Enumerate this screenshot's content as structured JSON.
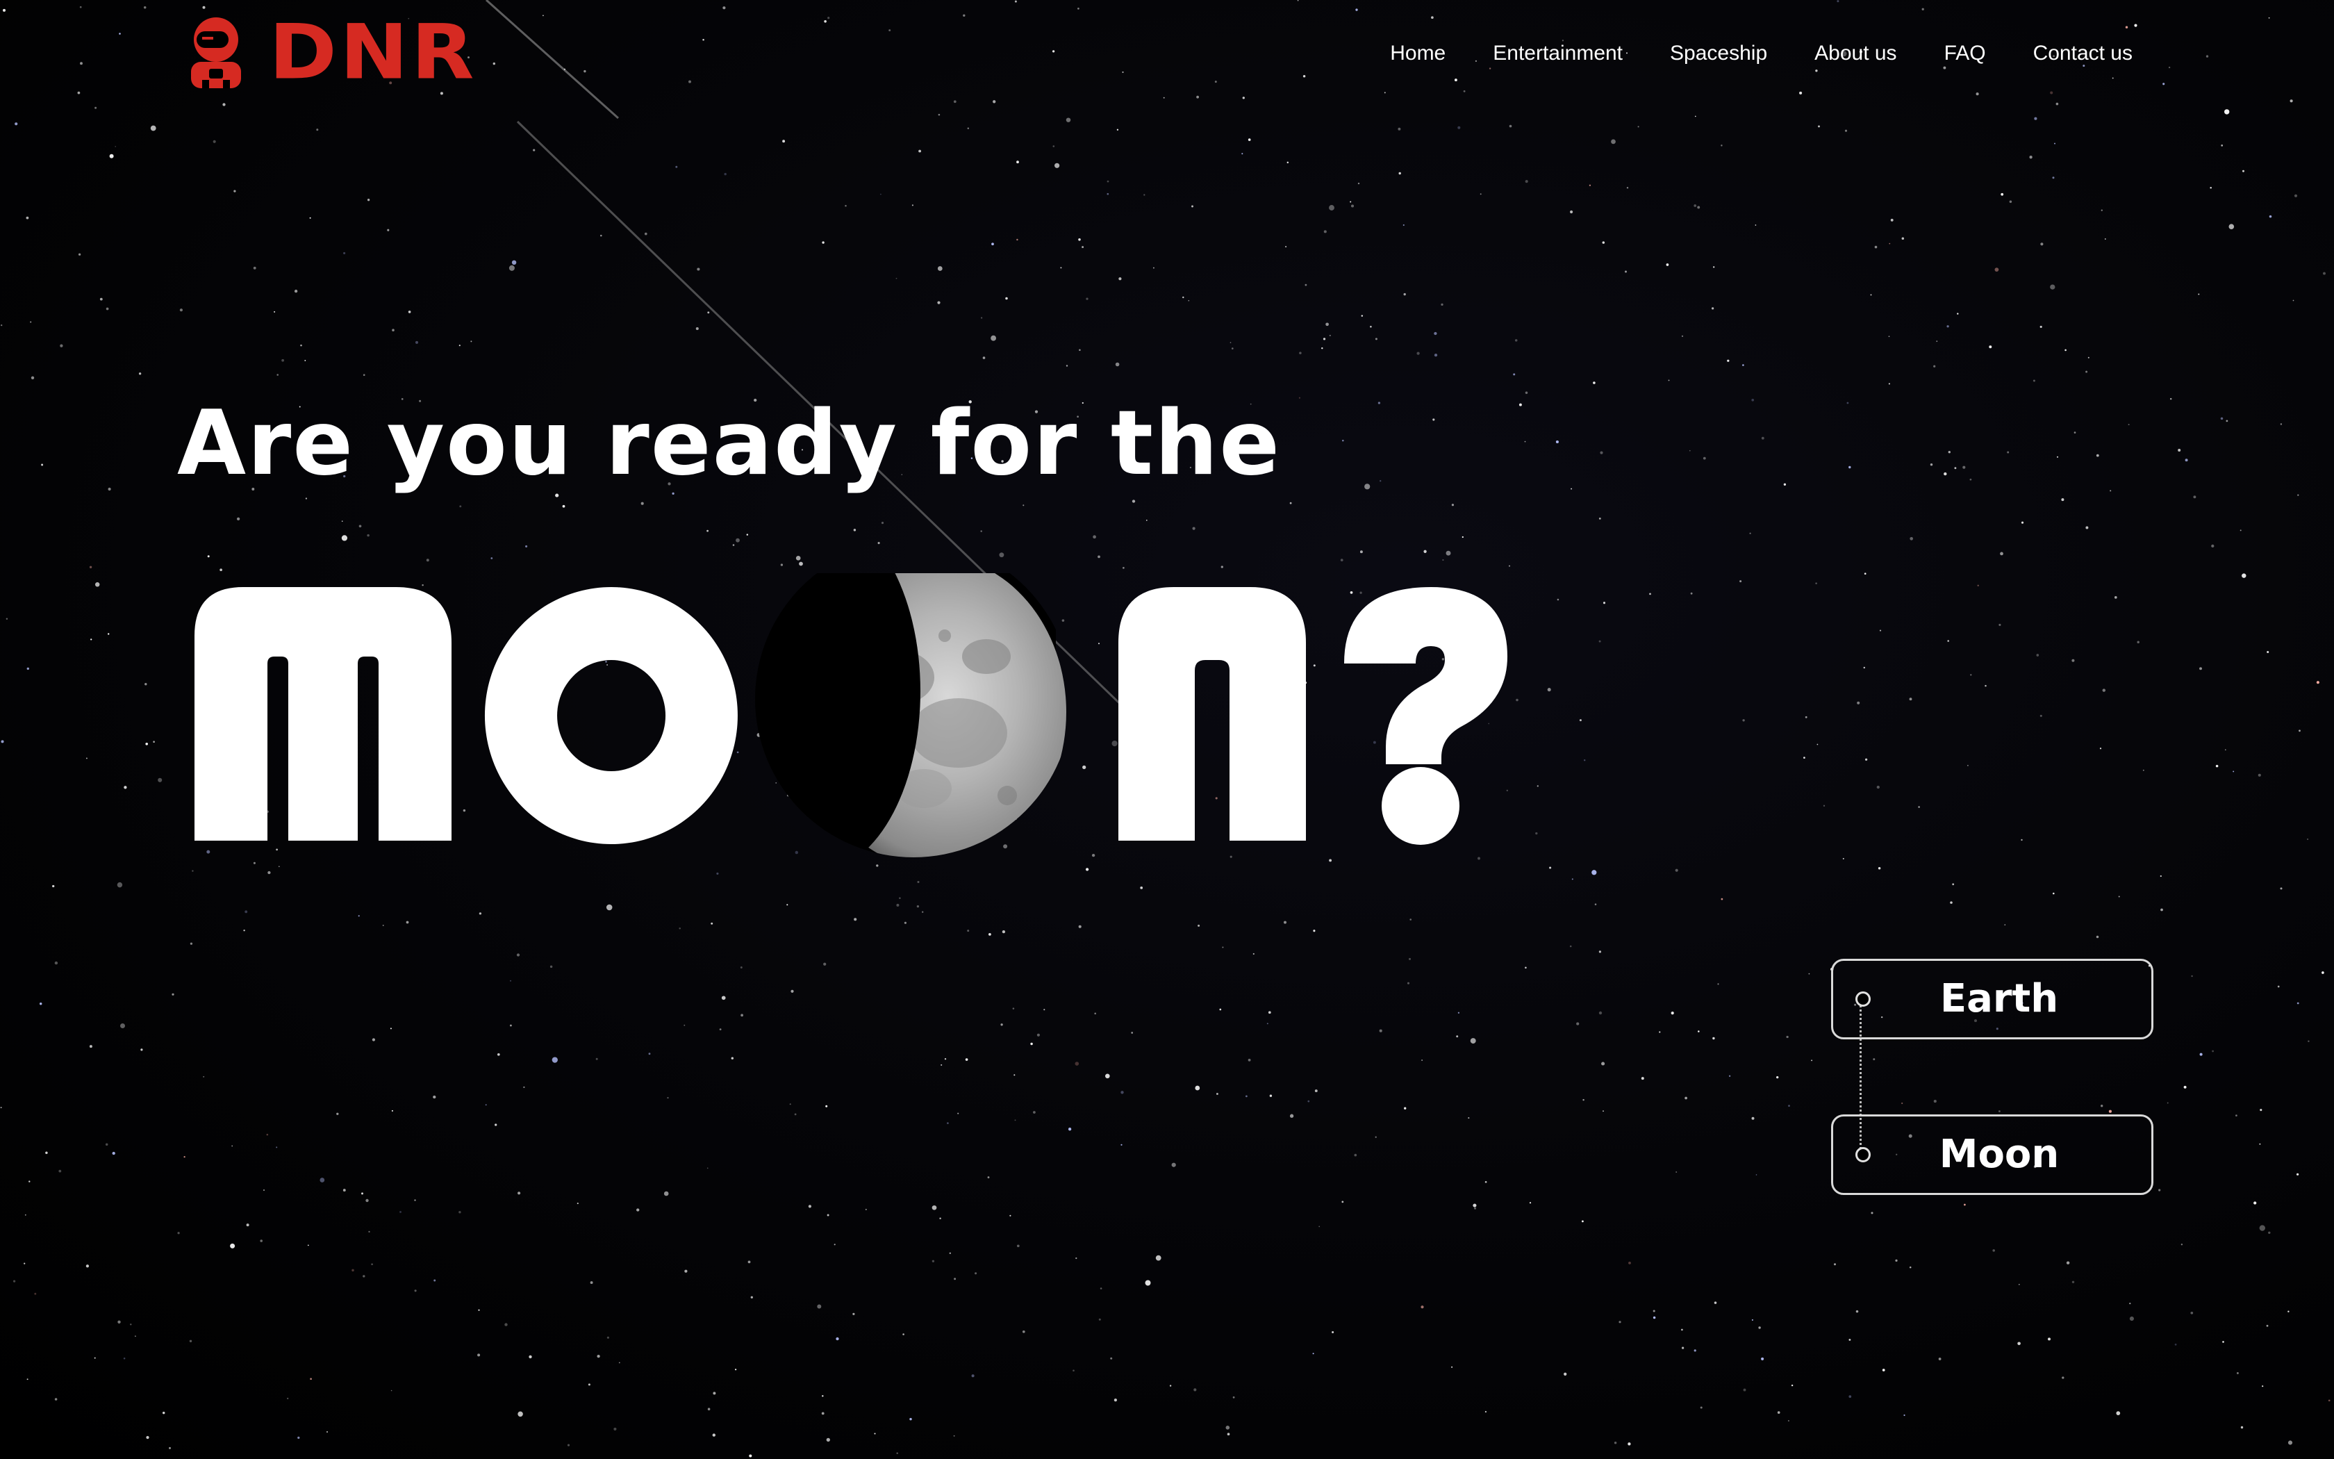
{
  "brand": {
    "name": "DNR",
    "logo_icon": "astronaut-icon",
    "color": "#d62a22"
  },
  "nav": {
    "items": [
      {
        "label": "Home"
      },
      {
        "label": "Entertainment"
      },
      {
        "label": "Spaceship"
      },
      {
        "label": "About us"
      },
      {
        "label": "FAQ"
      },
      {
        "label": "Contact us"
      }
    ]
  },
  "hero": {
    "tagline": "Are you ready for the",
    "headline": "MOON?",
    "moon_image": "moon-photo"
  },
  "trip": {
    "options": [
      {
        "label": "Earth",
        "icon": "circle-icon"
      },
      {
        "label": "Moon",
        "icon": "circle-icon"
      }
    ]
  },
  "colors": {
    "background": "#000000",
    "text": "#ffffff",
    "border": "#d9d9d9"
  }
}
